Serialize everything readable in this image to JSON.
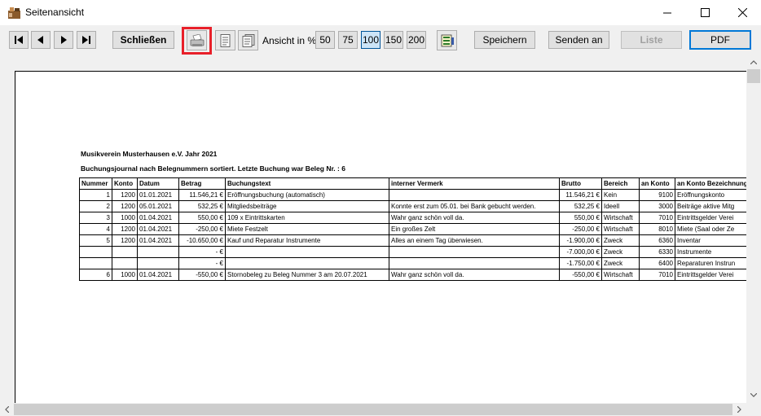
{
  "window": {
    "title": "Seitenansicht"
  },
  "toolbar": {
    "close_label": "Schließen",
    "zoom_label": "Ansicht in %",
    "zoom_options": [
      "50",
      "75",
      "100",
      "150",
      "200"
    ],
    "zoom_selected": "100",
    "save_label": "Speichern",
    "send_label": "Senden an",
    "list_label": "Liste",
    "pdf_label": "PDF"
  },
  "report": {
    "title": "Musikverein Musterhausen e.V. Jahr 2021",
    "subtitle": "Buchungsjournal nach Belegnummern sortiert. Letzte Buchung war Beleg Nr. : 6",
    "columns": [
      "Nummer",
      "Konto",
      "Datum",
      "Betrag",
      "Buchungstext",
      "interner Vermerk",
      "Brutto",
      "Bereich",
      "an Konto",
      "an Konto Bezeichnung"
    ],
    "rows": [
      [
        "1",
        "1200",
        "01.01.2021",
        "11.546,21 €",
        "Eröffnungsbuchung (automatisch)",
        "",
        "11.546,21 €",
        "Kein",
        "9100",
        "Eröffnungskonto"
      ],
      [
        "2",
        "1200",
        "05.01.2021",
        "532,25 €",
        "Mitgliedsbeiträge",
        "Konnte erst zum 05.01. bei Bank gebucht werden.",
        "532,25 €",
        "Ideell",
        "3000",
        "Beiträge aktive Mitg"
      ],
      [
        "3",
        "1000",
        "01.04.2021",
        "550,00 €",
        "109 x Eintrittskarten",
        "Wahr ganz schön voll da.",
        "550,00 €",
        "Wirtschaft",
        "7010",
        "Eintrittsgelder Verei"
      ],
      [
        "4",
        "1200",
        "01.04.2021",
        "-250,00 €",
        "Miete Festzelt",
        "Ein großes Zelt",
        "-250,00 €",
        "Wirtschaft",
        "8010",
        "Miete (Saal oder Ze"
      ],
      [
        "5",
        "1200",
        "01.04.2021",
        "-10.650,00 €",
        "Kauf und Reparatur Instrumente",
        "Alles an einem Tag überwiesen.",
        "-1.900,00 €",
        "Zweck",
        "6360",
        "Inventar"
      ],
      [
        "",
        "",
        "",
        "- €",
        "",
        "",
        "-7.000,00 €",
        "Zweck",
        "6330",
        "Instrumente"
      ],
      [
        "",
        "",
        "",
        "- €",
        "",
        "",
        "-1.750,00 €",
        "Zweck",
        "6400",
        "Reparaturen Instrun"
      ],
      [
        "6",
        "1000",
        "01.04.2021",
        "-550,00 €",
        "Stornobeleg zu Beleg Nummer 3 am 20.07.2021",
        "Wahr ganz schön voll da.",
        "-550,00 €",
        "Wirtschaft",
        "7010",
        "Eintrittsgelder Verei"
      ]
    ]
  }
}
